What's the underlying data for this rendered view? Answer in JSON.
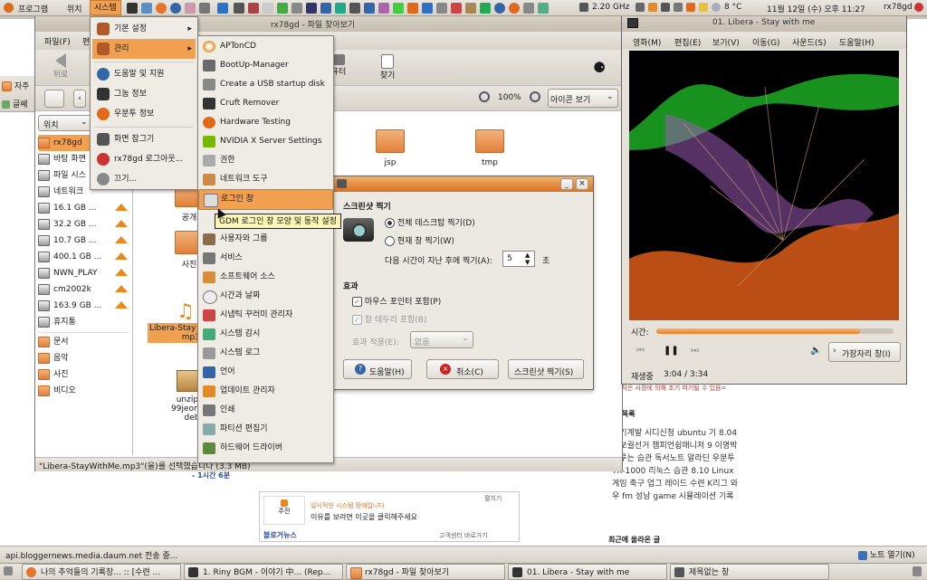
{
  "top_panel": {
    "apps": "프로그램",
    "places": "위치",
    "system": "시스템",
    "cpu": "2.20 GHz",
    "weather": "8 °C",
    "clock": "11월 12일 (수) 오후 11:27",
    "user": "rx78gd"
  },
  "system_menu": [
    "기본 설정",
    "관리",
    "도움말 및 지원",
    "그놈 정보",
    "우분투 정보",
    "화면 잠그기",
    "rx78gd 로그아웃...",
    "끄기..."
  ],
  "admin_menu": [
    "APTonCD",
    "BootUp-Manager",
    "Create a USB startup disk",
    "Cruft Remover",
    "Hardware Testing",
    "NVIDIA X Server Settings",
    "권한",
    "네트워크 도구",
    "로그인 창",
    "사용자와 그룹",
    "서비스",
    "소프트웨어 소스",
    "시간과 날짜",
    "시냅틱 꾸러미 관리자",
    "시스템 감시",
    "시스템 로그",
    "언어",
    "업데이트 관리자",
    "인쇄",
    "파티션 편집기",
    "하드웨어 드라이버"
  ],
  "tooltip": "GDM 로그인 창 모양 및 동작 설정",
  "file_manager": {
    "title": "rx78gd - 파일 찾아보기",
    "menus": [
      "파일(F)",
      "편"
    ],
    "toolbar": {
      "back": "뒤로",
      "computer": "퓨터",
      "search": "찾기"
    },
    "zoom": "100%",
    "view": "아이콘 보기",
    "places_label": "위치",
    "sidebar": [
      "rx78gd",
      "바탕 화면",
      "파일 시스",
      "네트워크",
      "16.1 GB ...",
      "32.2 GB ...",
      "10.7 GB ...",
      "400.1 GB ...",
      "NWN_PLAY",
      "cm2002k",
      "163.9 GB ...",
      "휴지통",
      "문서",
      "음악",
      "사진",
      "비디오"
    ],
    "files": {
      "jsp": "jsp",
      "tmp": "tmp",
      "public": "공개",
      "photo": "사진",
      "mp3_1": "Libera-Stay",
      "mp3_2": "mp3",
      "unzip1": "unzip_5",
      "unzip2": "99jeongsw2",
      "unzip3": "deb"
    },
    "status": "\"Libera-StayWithMe.mp3\"(을)를 선택했습니다 (3.3 MB)"
  },
  "screenshot_dialog": {
    "title": "스크린샷 찍기",
    "opt_desktop": "전체 데스크탑 찍기(D)",
    "opt_window": "현재 창 찍기(W)",
    "delay_label": "다음 시간이 지난 후에 찍기(A):",
    "delay_value": "5",
    "delay_unit": "초",
    "effects": "효과",
    "include_pointer": "마우스 포인터 포함(P)",
    "include_border": "창 테두리 포함(B)",
    "apply_effect": "효과 적용(E):",
    "effect_value": "없음",
    "help": "도움말(H)",
    "cancel": "취소(C)",
    "take": "스크린샷 찍기(S)"
  },
  "player": {
    "title": "01. Libera - Stay with me",
    "menus": [
      "영화(M)",
      "편집(E)",
      "보기(V)",
      "이동(G)",
      "사운드(S)",
      "도움말(H)"
    ],
    "time_label": "시간:",
    "status": "재생중",
    "time": "3:04 / 3:34",
    "progress": 0.86,
    "sidebar_btn": "가장자리 창(I)"
  },
  "browser_bg": {
    "tab1": "자주",
    "tab2": "글쎄",
    "red_note": "= 제작은 사정에 의해 조기 파기될 수 있음=",
    "list_title": "태그목록",
    "tags": "자기계발 시디신청 ubuntu 기 8.04 재보궐선거 챔피언쉽매니저 9 이명박 미루는 습관 독서노트 알라딘 우분투 TX-1000 리눅스 습관 8.10 Linux 게임 축구 업그 레이드 수련 K리그 와우 fm 성남 game 시뮬레이션 기록",
    "recent": "최근에 올라온 글",
    "time_link": "- 1시간 6분",
    "notice1": "일시적인 시스템 장애입니다",
    "notice2": "이유를 보려면 이곳을 클릭해주세요",
    "notice_side": "주전",
    "notice_fold": "펼치기",
    "notice_brand": "블로거뉴스",
    "notice_link": "고객센터 바로가기",
    "status_text": "api.bloggernews.media.daum.net 전송 중...",
    "notes": "노트 열기(N)"
  },
  "taskbar": [
    "나의 추억들의 기록장... :: [수련 ...",
    "1. Riny BGM - 이야기 中... (Rep...",
    "rx78gd - 파일 찾아보기",
    "01. Libera - Stay with me",
    "제목없는 창"
  ],
  "colors": {
    "highlight": "#f0a050",
    "accent": "#d96f22",
    "panel": "#dedad2"
  }
}
